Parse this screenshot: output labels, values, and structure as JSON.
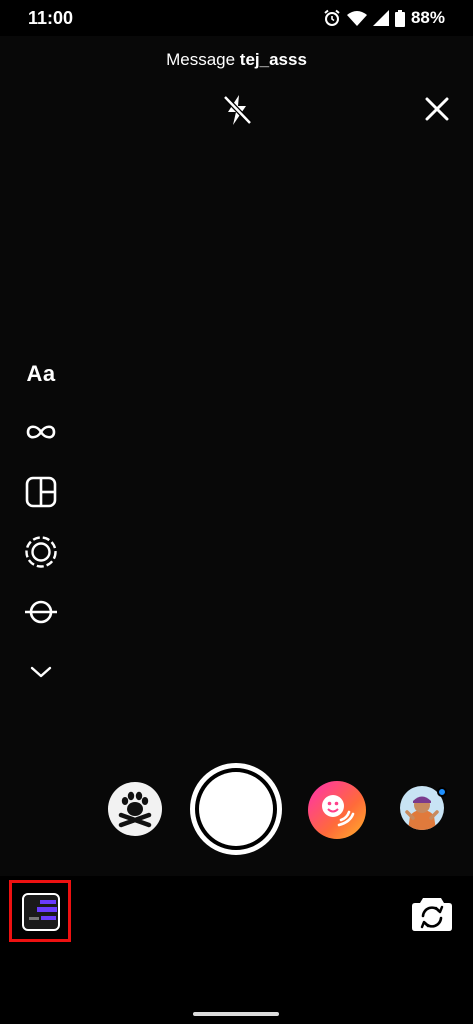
{
  "status_bar": {
    "time": "11:00",
    "battery": "88%",
    "icons": [
      "alarm-icon",
      "wifi-icon",
      "signal-icon",
      "battery-icon"
    ]
  },
  "header": {
    "prefix": "Message ",
    "username": "tej_asss",
    "flash_icon": "flash-off-icon",
    "close_icon": "close-icon"
  },
  "side_tools": {
    "create_label": "Aa",
    "items": [
      "create-text",
      "boomerang-icon",
      "layout-icon",
      "multi-capture-icon",
      "level-icon",
      "chevron-down-icon"
    ]
  },
  "capture": {
    "effects": [
      "paw-skull-effect",
      "smile-effect",
      "avatar-effect"
    ],
    "shutter": "capture-button"
  },
  "bottom": {
    "gallery": "gallery-thumbnail",
    "flip_icon": "flip-camera-icon"
  },
  "colors": {
    "background": "#000000",
    "highlight": "#e11111",
    "notification_dot": "#1e90ff"
  }
}
